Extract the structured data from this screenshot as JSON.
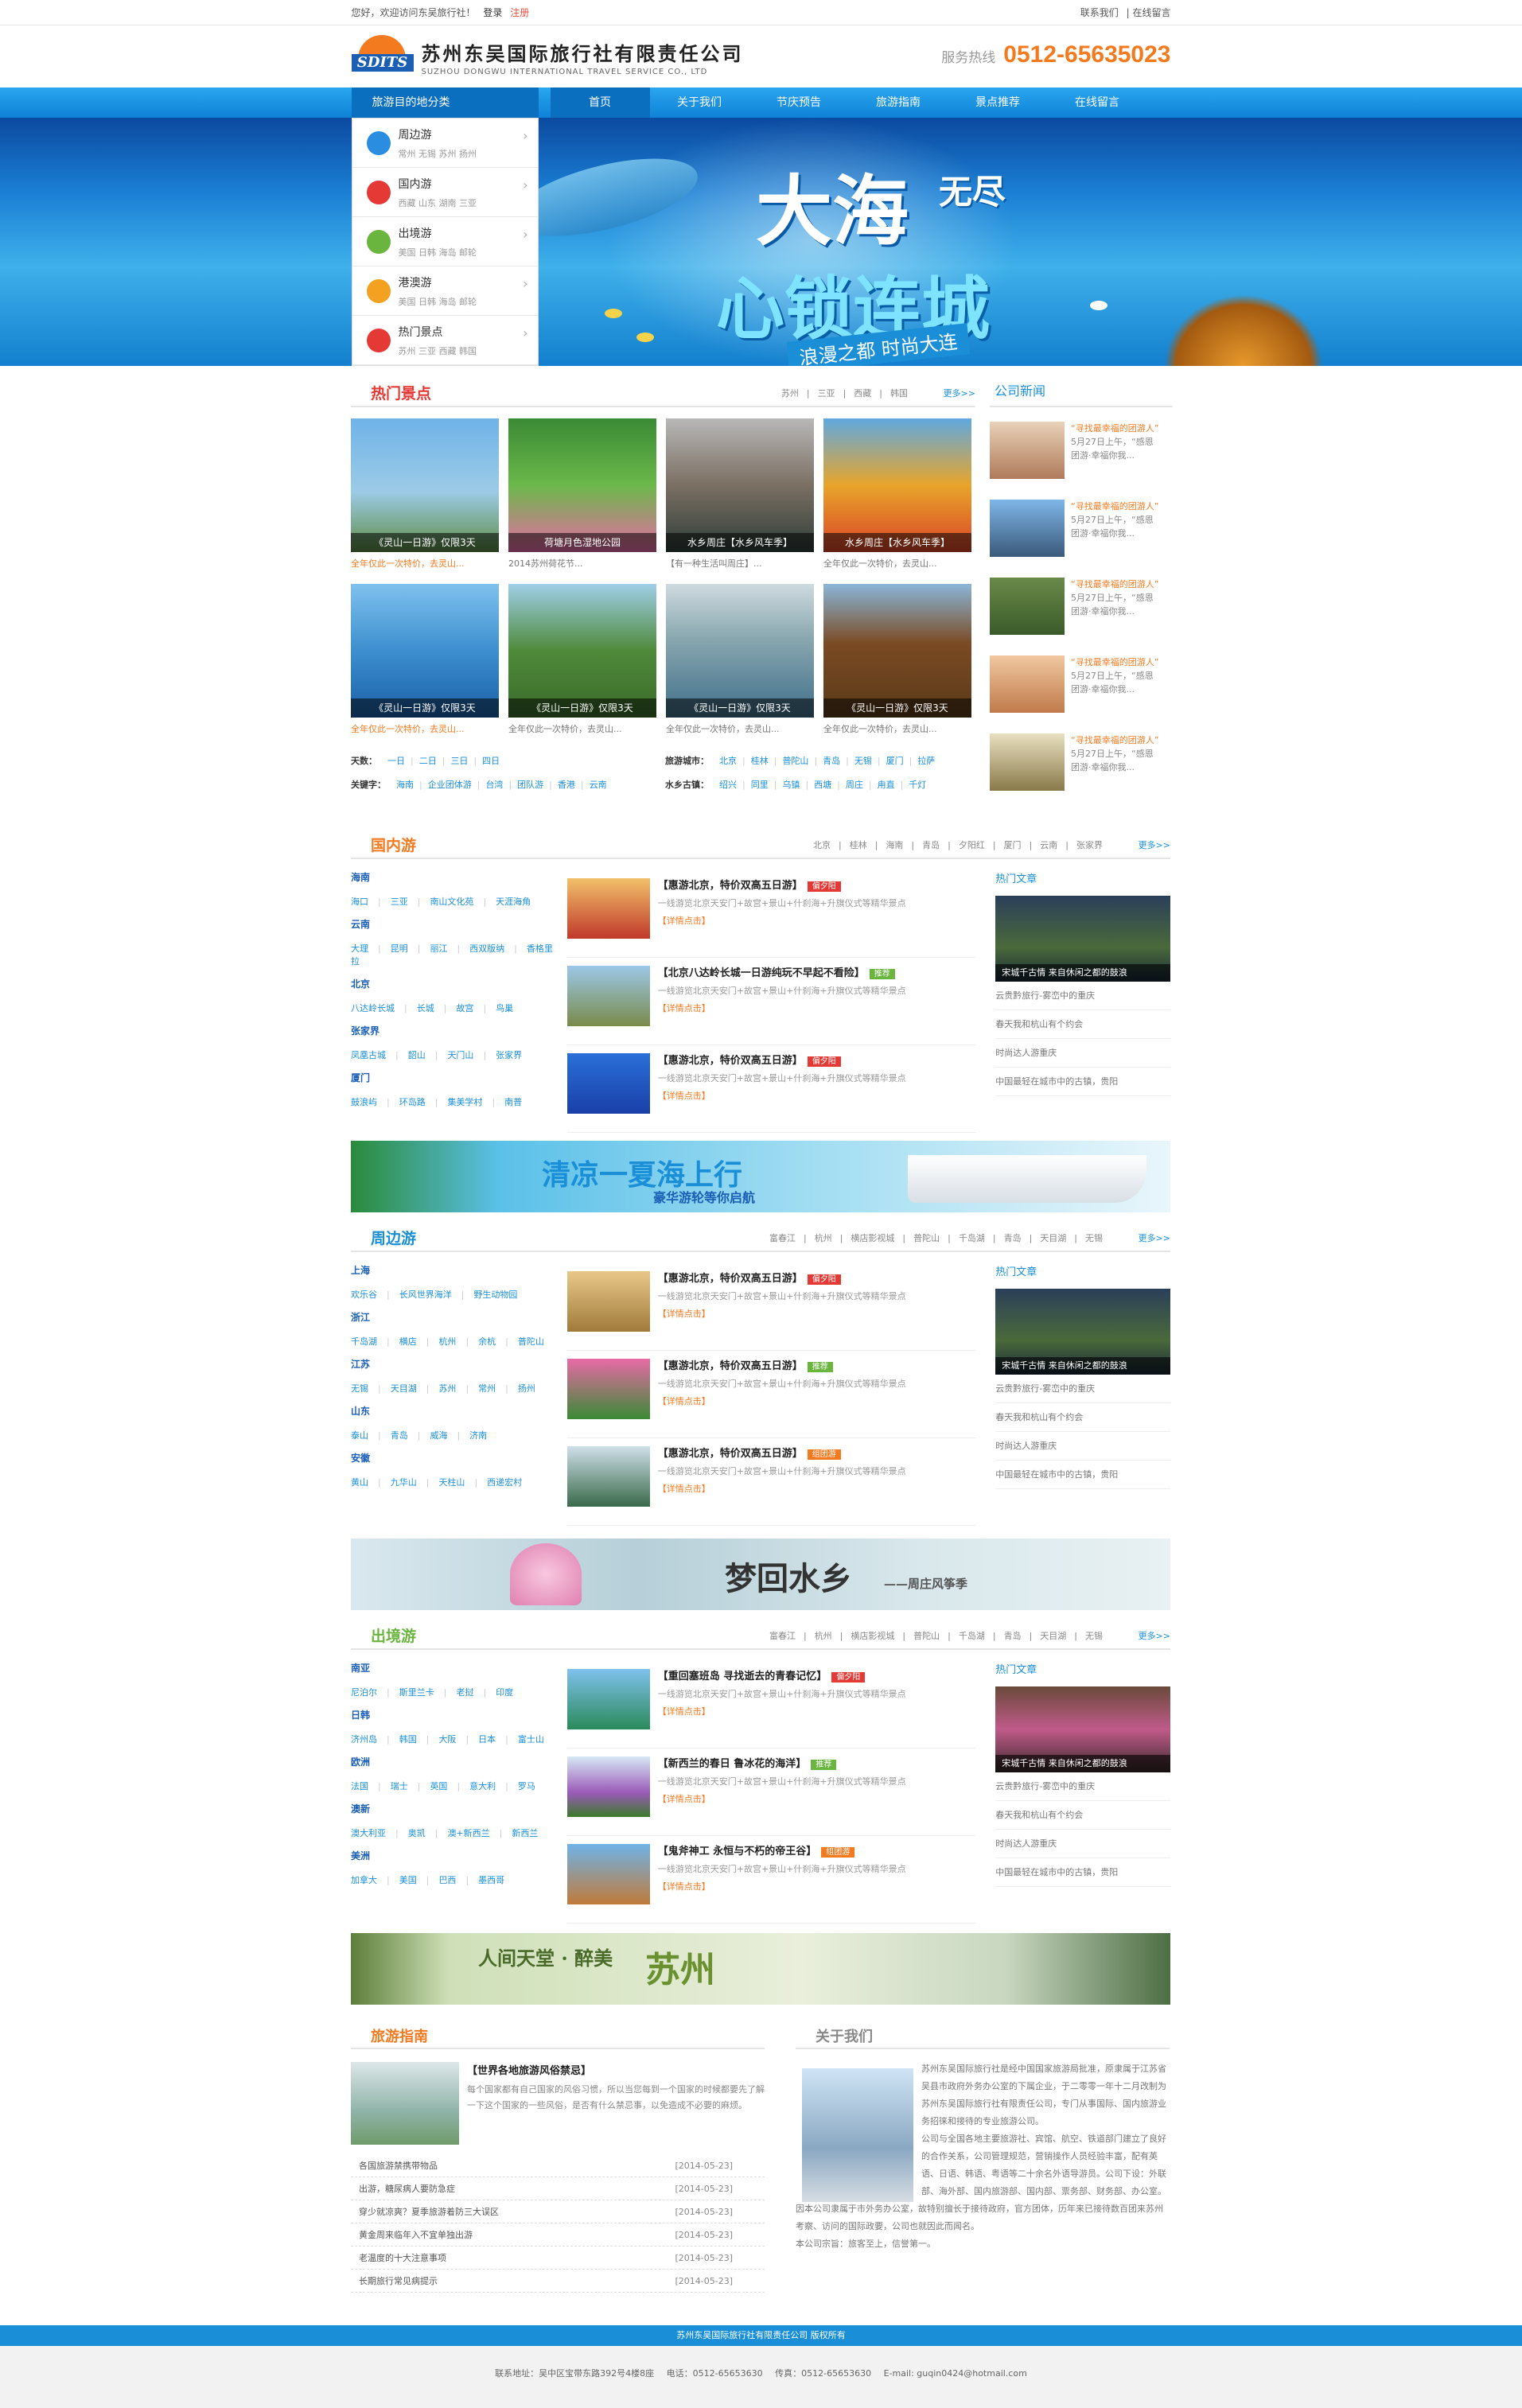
{
  "topbar": {
    "welcome": "您好，欢迎访问东吴旅行社！",
    "login": "登录",
    "register": "注册",
    "contact": "联系我们",
    "message": "在线留言"
  },
  "header": {
    "logo_mark": "SDITS",
    "name_cn": "苏州东吴国际旅行社有限责任公司",
    "name_en": "SUZHOU DONGWU INTERNATIONAL TRAVEL SERVICE CO., LTD",
    "hotline_label": "服务热线",
    "hotline": "0512-65635023"
  },
  "nav": {
    "category_title": "旅游目的地分类",
    "items": [
      "首页",
      "关于我们",
      "节庆预告",
      "旅游指南",
      "景点推荐",
      "在线留言"
    ]
  },
  "categories": [
    {
      "name": "周边游",
      "sub": "常州  无锡  苏州  扬州",
      "icon": "map-pin-icon",
      "color": "#2a8de0"
    },
    {
      "name": "国内游",
      "sub": "西藏  山东  湖南  三亚",
      "icon": "china-map-icon",
      "color": "#e53935"
    },
    {
      "name": "出境游",
      "sub": "美国  日韩  海岛  邮轮",
      "icon": "globe-icon",
      "color": "#6ab53e"
    },
    {
      "name": "港澳游",
      "sub": "美国  日韩  海岛  邮轮",
      "icon": "mountain-icon",
      "color": "#f4a020"
    },
    {
      "name": "热门景点",
      "sub": "苏州  三亚  西藏  韩国",
      "icon": "sun-icon",
      "color": "#e53935"
    }
  ],
  "banner": {
    "line1": "大海",
    "line1b": "无尽",
    "line2": "心锁连城",
    "line3": "浪漫之都   时尚大连"
  },
  "hot": {
    "title": "热门景点",
    "tags": [
      "苏州",
      "三亚",
      "西藏",
      "韩国"
    ],
    "more": "更多>>",
    "items": [
      {
        "cap": "《灵山一日游》仅限3天",
        "desc": "全年仅此一次特价，去灵山...",
        "orange": true
      },
      {
        "cap": "荷塘月色湿地公园",
        "desc": "2014苏州荷花节...",
        "orange": false
      },
      {
        "cap": "水乡周庄【水乡风车季】",
        "desc": "【有一种生活叫周庄】...",
        "orange": false
      },
      {
        "cap": "水乡周庄【水乡风车季】",
        "desc": "全年仅此一次特价，去灵山...",
        "orange": false
      },
      {
        "cap": "《灵山一日游》仅限3天",
        "desc": "全年仅此一次特价，去灵山...",
        "orange": true
      },
      {
        "cap": "《灵山一日游》仅限3天",
        "desc": "全年仅此一次特价，去灵山...",
        "orange": false
      },
      {
        "cap": "《灵山一日游》仅限3天",
        "desc": "全年仅此一次特价，去灵山...",
        "orange": false
      },
      {
        "cap": "《灵山一日游》仅限3天",
        "desc": "全年仅此一次特价，去灵山...",
        "orange": false
      }
    ],
    "filters": [
      {
        "label": "天数：",
        "items": [
          "一日",
          "二日",
          "三日",
          "四日"
        ]
      },
      {
        "label": "旅游城市：",
        "items": [
          "北京",
          "桂林",
          "普陀山",
          "青岛",
          "无锡",
          "厦门",
          "拉萨"
        ]
      },
      {
        "label": "关键字：",
        "items": [
          "海南",
          "企业团体游",
          "台湾",
          "团队游",
          "香港",
          "云南"
        ]
      },
      {
        "label": "水乡古镇：",
        "items": [
          "绍兴",
          "同里",
          "乌镇",
          "西塘",
          "周庄",
          "甪直",
          "千灯"
        ]
      }
    ]
  },
  "news": {
    "title": "公司新闻",
    "items": [
      {
        "t": "“寻找最幸福的团游人”",
        "d1": "5月27日上午，“感恩",
        "d2": "团游·幸福你我..."
      },
      {
        "t": "“寻找最幸福的团游人”",
        "d1": "5月27日上午，“感恩",
        "d2": "团游·幸福你我..."
      },
      {
        "t": "“寻找最幸福的团游人”",
        "d1": "5月27日上午，“感恩",
        "d2": "团游·幸福你我..."
      },
      {
        "t": "“寻找最幸福的团游人”",
        "d1": "5月27日上午，“感恩",
        "d2": "团游·幸福你我..."
      },
      {
        "t": "“寻找最幸福的团游人”",
        "d1": "5月27日上午，“感恩",
        "d2": "团游·幸福你我..."
      }
    ]
  },
  "domestic": {
    "title": "国内游",
    "tags": [
      "北京",
      "桂林",
      "海南",
      "青岛",
      "夕阳红",
      "厦门",
      "云南",
      "张家界"
    ],
    "more": "更多>>",
    "groups": [
      {
        "h": "海南",
        "l": [
          "海口",
          "三亚",
          "南山文化苑",
          "天涯海角"
        ]
      },
      {
        "h": "云南",
        "l": [
          "大理",
          "昆明",
          "丽江",
          "西双版纳",
          "香格里拉"
        ]
      },
      {
        "h": "北京",
        "l": [
          "八达岭长城",
          "长城",
          "故宫",
          "鸟巢"
        ]
      },
      {
        "h": "张家界",
        "l": [
          "凤凰古城",
          "韶山",
          "天门山",
          "张家界"
        ]
      },
      {
        "h": "厦门",
        "l": [
          "鼓浪屿",
          "环岛路",
          "集美学村",
          "南普"
        ]
      }
    ],
    "items": [
      {
        "t": "【惠游北京，特价双高五日游】",
        "badge": "偏夕阳",
        "bc": "#e53935",
        "d": "一线游览北京天安门+故宫+景山+什刹海+升旗仪式等精华景点",
        "m": "【详情点击】"
      },
      {
        "t": "【北京八达岭长城一日游纯玩不早起不看险】",
        "badge": "推荐",
        "bc": "#6ab53e",
        "d": "一线游览北京天安门+故宫+景山+什刹海+升旗仪式等精华景点",
        "m": "【详情点击】"
      },
      {
        "t": "【惠游北京，特价双高五日游】",
        "badge": "偏夕阳",
        "bc": "#e53935",
        "d": "一线游览北京天安门+故宫+景山+什刹海+升旗仪式等精华景点",
        "m": "【详情点击】"
      }
    ],
    "hot_title": "热门文章",
    "art_cap": "宋城千古情  来自休闲之都的鼓浪",
    "list": [
      "云贵黔旅行-雾峦中的重庆",
      "春天我和杭山有个约会",
      "时尚达人游重庆",
      "中国最轻在城市中的古镇，贵阳"
    ]
  },
  "ad1": {
    "t1": "清凉一夏海上行",
    "t2": "豪华游轮等你启航"
  },
  "nearby": {
    "title": "周边游",
    "tags": [
      "富春江",
      "杭州",
      "横店影视城",
      "普陀山",
      "千岛湖",
      "青岛",
      "天目湖",
      "无锡"
    ],
    "more": "更多>>",
    "groups": [
      {
        "h": "上海",
        "l": [
          "欢乐谷",
          "长风世界海洋",
          "野生动物园"
        ]
      },
      {
        "h": "浙江",
        "l": [
          "千岛湖",
          "横店",
          "杭州",
          "余杭",
          "普陀山"
        ]
      },
      {
        "h": "江苏",
        "l": [
          "无锡",
          "天目湖",
          "苏州",
          "常州",
          "扬州"
        ]
      },
      {
        "h": "山东",
        "l": [
          "泰山",
          "青岛",
          "威海",
          "济南"
        ]
      },
      {
        "h": "安徽",
        "l": [
          "黄山",
          "九华山",
          "天柱山",
          "西递宏村"
        ]
      }
    ],
    "items": [
      {
        "t": "【惠游北京，特价双高五日游】",
        "badge": "偏夕阳",
        "bc": "#e53935",
        "d": "一线游览北京天安门+故宫+景山+什刹海+升旗仪式等精华景点",
        "m": "【详情点击】"
      },
      {
        "t": "【惠游北京，特价双高五日游】",
        "badge": "推荐",
        "bc": "#6ab53e",
        "d": "一线游览北京天安门+故宫+景山+什刹海+升旗仪式等精华景点",
        "m": "【详情点击】"
      },
      {
        "t": "【惠游北京，特价双高五日游】",
        "badge": "组团游",
        "bc": "#f47a20",
        "d": "一线游览北京天安门+故宫+景山+什刹海+升旗仪式等精华景点",
        "m": "【详情点击】"
      }
    ],
    "hot_title": "热门文章",
    "art_cap": "宋城千古情  来自休闲之都的鼓浪",
    "list": [
      "云贵黔旅行-雾峦中的重庆",
      "春天我和杭山有个约会",
      "时尚达人游重庆",
      "中国最轻在城市中的古镇，贵阳"
    ]
  },
  "ad2": {
    "t1": "梦回水乡",
    "t2": "——周庄风筝季"
  },
  "outbound": {
    "title": "出境游",
    "tags": [
      "富春江",
      "杭州",
      "横店影视城",
      "普陀山",
      "千岛湖",
      "青岛",
      "天目湖",
      "无锡"
    ],
    "more": "更多>>",
    "groups": [
      {
        "h": "南亚",
        "l": [
          "尼泊尔",
          "斯里兰卡",
          "老挝",
          "印度"
        ]
      },
      {
        "h": "日韩",
        "l": [
          "济州岛",
          "韩国",
          "大阪",
          "日本",
          "富士山"
        ]
      },
      {
        "h": "欧洲",
        "l": [
          "法国",
          "瑞士",
          "英国",
          "意大利",
          "罗马"
        ]
      },
      {
        "h": "澳新",
        "l": [
          "澳大利亚",
          "奥凯",
          "澳+新西兰",
          "新西兰"
        ]
      },
      {
        "h": "美洲",
        "l": [
          "加拿大",
          "美国",
          "巴西",
          "墨西哥"
        ]
      }
    ],
    "items": [
      {
        "t": "【重回塞班岛  寻找逝去的青春记忆】",
        "badge": "偏夕阳",
        "bc": "#e53935",
        "d": "一线游览北京天安门+故宫+景山+什刹海+升旗仪式等精华景点",
        "m": "【详情点击】"
      },
      {
        "t": "【新西兰的春日  鲁冰花的海洋】",
        "badge": "推荐",
        "bc": "#6ab53e",
        "d": "一线游览北京天安门+故宫+景山+什刹海+升旗仪式等精华景点",
        "m": "【详情点击】"
      },
      {
        "t": "【鬼斧神工  永恒与不朽的帝王谷】",
        "badge": "组团游",
        "bc": "#f47a20",
        "d": "一线游览北京天安门+故宫+景山+什刹海+升旗仪式等精华景点",
        "m": "【详情点击】"
      }
    ],
    "hot_title": "热门文章",
    "art_cap": "宋城千古情  来自休闲之都的鼓浪",
    "list": [
      "云贵黔旅行-雾峦中的重庆",
      "春天我和杭山有个约会",
      "时尚达人游重庆",
      "中国最轻在城市中的古镇，贵阳"
    ]
  },
  "ad3": {
    "t1": "人间天堂 · 醉美",
    "t2": "苏州"
  },
  "guide": {
    "title": "旅游指南",
    "top_title": "【世界各地旅游风俗禁忌】",
    "top_desc": "每个国家都有自己国家的风俗习惯，所以当您每到一个国家的时候都要先了解一下这个国家的一些风俗，是否有什么禁忌事，以免造成不必要的麻烦。",
    "list": [
      {
        "t": "各国旅游禁携带物品",
        "d": "[2014-05-23]"
      },
      {
        "t": "出游，糖尿病人要防急症",
        "d": "[2014-05-23]"
      },
      {
        "t": "穿少就凉爽？夏季旅游着防三大误区",
        "d": "[2014-05-23]"
      },
      {
        "t": "黄金周来临年入不宜单独出游",
        "d": "[2014-05-23]"
      },
      {
        "t": "老温度的十大注意事项",
        "d": "[2014-05-23]"
      },
      {
        "t": "长期旅行常见病提示",
        "d": "[2014-05-23]"
      }
    ]
  },
  "about": {
    "title": "关于我们",
    "p1": "苏州东吴国际旅行社是经中国国家旅游局批准，原隶属于江苏省吴县市政府外务办公室的下属企业，于二零零一年十二月改制为苏州东吴国际旅行社有限责任公司，专门从事国际、国内旅游业务招徕和接待的专业旅游公司。",
    "p2": "公司与全国各地主要旅游社、宾馆、航空、铁道部门建立了良好的合作关系，公司管理规范，营销操作人员经验丰富，配有英语、日语、韩语、粤语等二十余名外语导游员。公司下设：外联部、海外部、国内旅游部、国内部、票务部、财务部、办公室。",
    "p3": "因本公司隶属于市外务办公室，故特别擅长于接待政府，官方团体，历年来已接待数百团来苏州考察、访问的国际政要，公司也就因此而闻名。",
    "p4": "本公司宗旨：旅客至上，信誉第一。"
  },
  "footer": {
    "copyright": "苏州东吴国际旅行社有限责任公司  版权所有",
    "addr": "联系地址：吴中区宝带东路392号4楼8座",
    "tel": "电话：0512-65653630",
    "fax": "传真：0512-65653630",
    "email": "E-mail: guqin0424@hotmail.com"
  }
}
